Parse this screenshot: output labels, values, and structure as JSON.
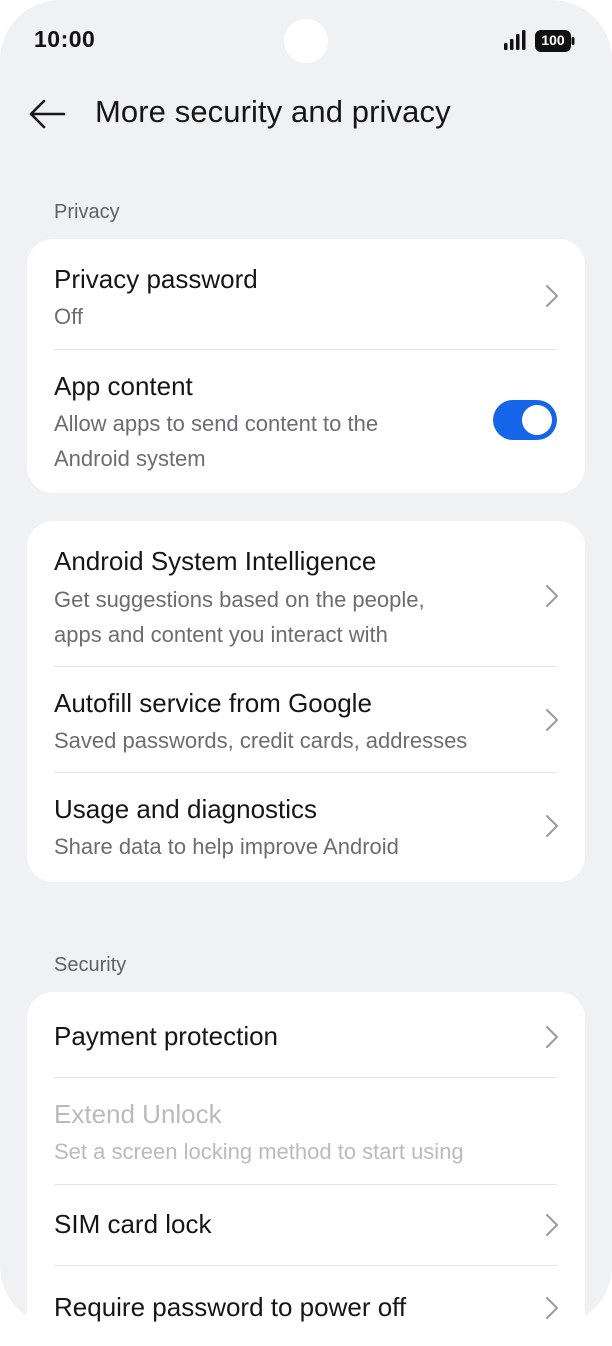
{
  "status_bar": {
    "time": "10:00",
    "battery": "100",
    "icons": [
      "signal-icon",
      "battery-icon"
    ]
  },
  "header": {
    "back_icon": "arrow-left-icon",
    "title": "More security and privacy"
  },
  "sections": {
    "privacy": {
      "label": "Privacy",
      "card1": {
        "privacy_password": {
          "title": "Privacy password",
          "subtitle": "Off"
        },
        "app_content": {
          "title": "App content",
          "subtitle_line1": "Allow apps to send content to the",
          "subtitle_line2": "Android system",
          "toggle_on": true
        }
      },
      "card2": {
        "asi": {
          "title": "Android System Intelligence",
          "subtitle_line1": "Get suggestions based on the people,",
          "subtitle_line2": "apps and content you interact with"
        },
        "autofill": {
          "title": "Autofill service from Google",
          "subtitle": "Saved passwords, credit cards, addresses"
        },
        "usage": {
          "title": "Usage and diagnostics",
          "subtitle": "Share data to help improve Android"
        }
      }
    },
    "security": {
      "label": "Security",
      "payment_protection": {
        "title": "Payment protection"
      },
      "extend_unlock": {
        "title": "Extend Unlock",
        "subtitle": "Set a screen locking method to start using",
        "disabled": true
      },
      "sim_lock": {
        "title": "SIM card lock"
      },
      "power_off": {
        "title": "Require password to power off"
      }
    }
  },
  "colors": {
    "background": "#f0f1f3",
    "card": "#ffffff",
    "accent": "#1565e8",
    "disabled_text": "#b9bbbe"
  }
}
